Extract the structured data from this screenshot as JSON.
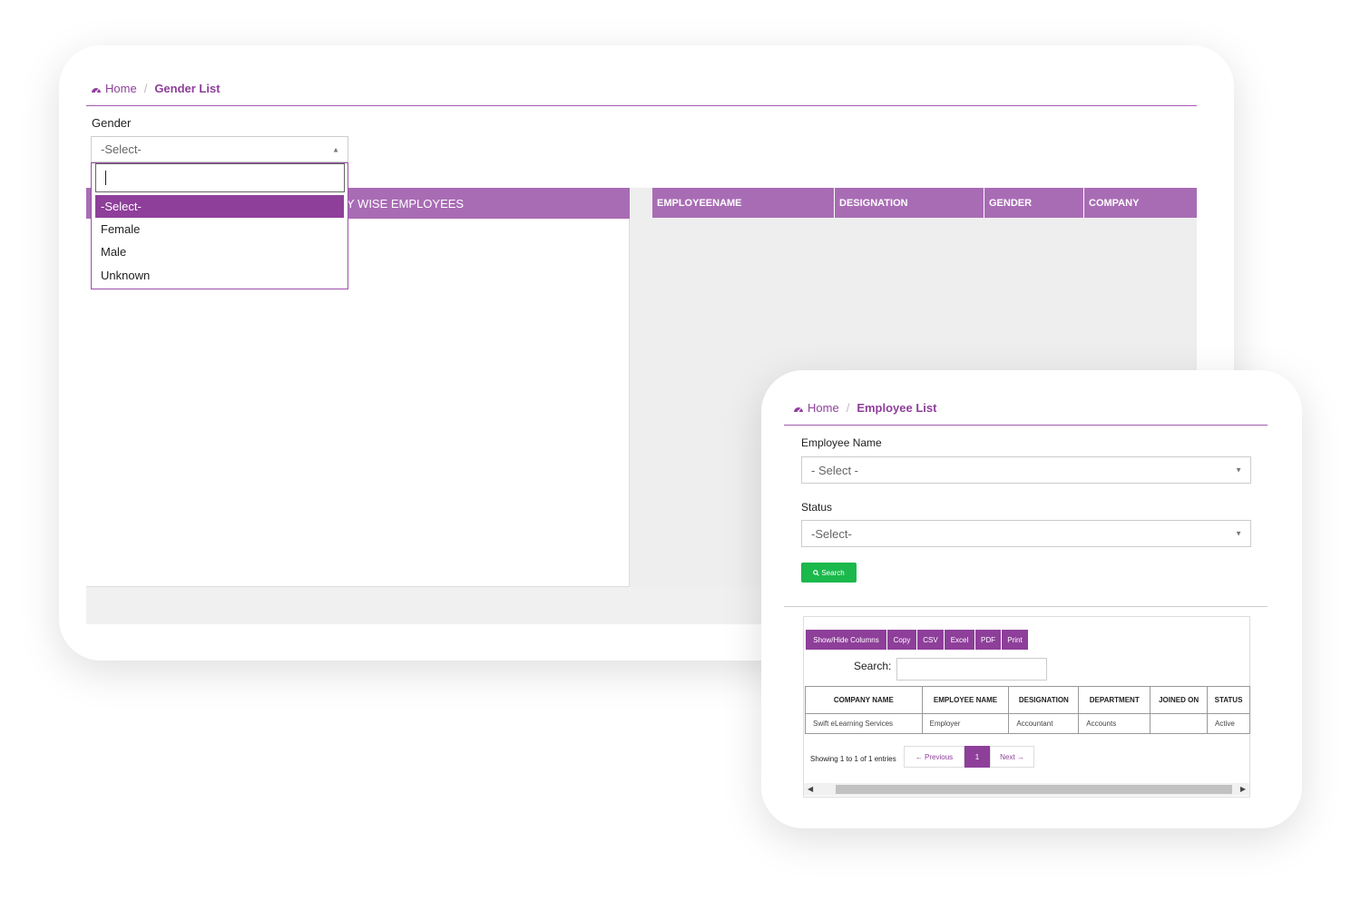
{
  "gender_list": {
    "breadcrumb": {
      "home": "Home",
      "separator": "/",
      "current": "Gender List"
    },
    "filter_label": "Gender",
    "select_value": "-Select-",
    "search_value": "",
    "options": [
      "-Select-",
      "Female",
      "Male",
      "Unknown"
    ],
    "selected_option": "-Select-",
    "panel_title_visible": "Y WISE EMPLOYEES",
    "table_headers": [
      "EMPLOYEENAME",
      "DESIGNATION",
      "GENDER",
      "COMPANY"
    ]
  },
  "employee_list": {
    "breadcrumb": {
      "home": "Home",
      "separator": "/",
      "current": "Employee List"
    },
    "employee_name_label": "Employee Name",
    "employee_name_value": "- Select -",
    "status_label": "Status",
    "status_value": "-Select-",
    "search_button": "Search",
    "toolbar": [
      "Show/Hide Columns",
      "Copy",
      "CSV",
      "Excel",
      "PDF",
      "Print"
    ],
    "search_label": "Search:",
    "search_input_value": "",
    "columns": [
      "COMPANY NAME",
      "EMPLOYEE NAME",
      "DESIGNATION",
      "DEPARTMENT",
      "JOINED ON",
      "STATUS"
    ],
    "rows": [
      [
        "Swift eLearning Services",
        "Employer",
        "Accountant",
        "Accounts",
        "",
        "Active"
      ]
    ],
    "info": "Showing 1 to 1 of 1 entries",
    "pagination": {
      "prev": "← Previous",
      "current": "1",
      "next": "Next →"
    }
  },
  "colors": {
    "accent": "#8e3f9a",
    "band": "#a86cb4",
    "success": "#1bb84c"
  },
  "icons": [
    "dashboard-icon",
    "search-icon",
    "caret-up-icon",
    "caret-down-icon",
    "scroll-left-icon",
    "scroll-right-icon"
  ]
}
